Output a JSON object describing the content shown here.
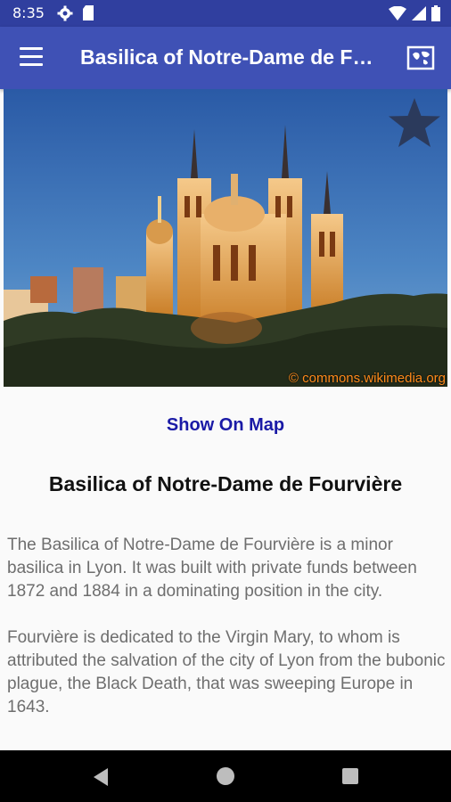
{
  "status_bar": {
    "time": "8:35",
    "icons_left": [
      "gear-icon",
      "sd-card-icon"
    ],
    "icons_right": [
      "wifi-icon",
      "signal-icon",
      "battery-icon"
    ]
  },
  "app_bar": {
    "title": "Basilica of Notre-Dame de Fourvière",
    "menu_icon": "hamburger-menu-icon",
    "action_icon": "map-icon",
    "background_color": "#3f51b5"
  },
  "hero": {
    "favorite_icon": "star-icon",
    "credit": "© commons.wikimedia.org"
  },
  "show_map_label": "Show On Map",
  "heading": "Basilica of Notre-Dame de Fourvière",
  "paragraphs": [
    "The Basilica of Notre-Dame de Fourvière is a minor basilica in Lyon. It was built with private funds between 1872 and 1884 in a dominating position in the city.",
    "Fourvière is dedicated to the Virgin Mary, to whom is attributed the salvation of the city of Lyon from the bubonic plague, the Black Death, that was sweeping Europe in 1643."
  ],
  "nav_bar": {
    "icons": [
      "back-icon",
      "home-icon",
      "recents-icon"
    ]
  }
}
